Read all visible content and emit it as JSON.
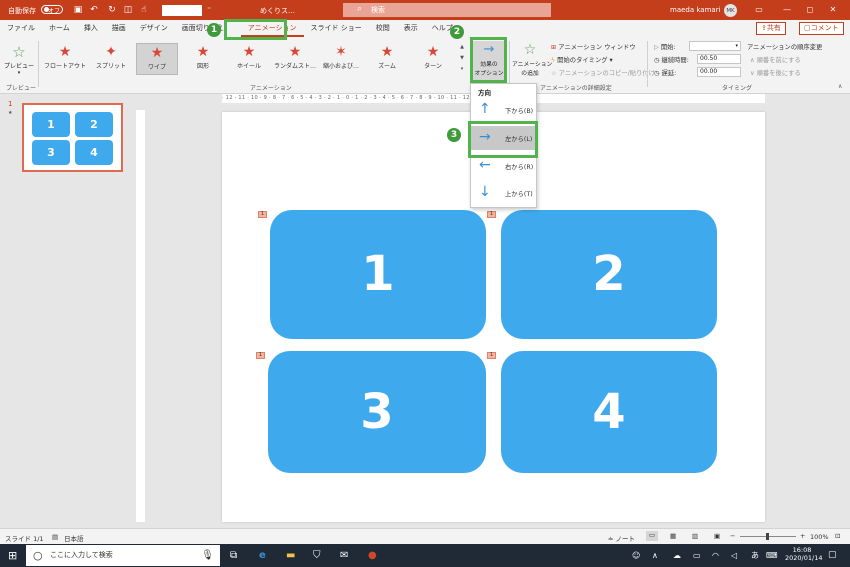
{
  "titlebar": {
    "autosave_label": "自動保存",
    "autosave_state": "オフ",
    "file_name": "めくりス…",
    "search_placeholder": "検索",
    "user_name": "maeda kamari",
    "user_initials": "MK",
    "bg_color": "#c43e1c"
  },
  "tabs": [
    {
      "label": "ファイル"
    },
    {
      "label": "ホーム"
    },
    {
      "label": "挿入"
    },
    {
      "label": "描画"
    },
    {
      "label": "デザイン"
    },
    {
      "label": "画面切り替え"
    },
    {
      "label": "アニメーション",
      "active": true
    },
    {
      "label": "スライド ショー"
    },
    {
      "label": "校閲"
    },
    {
      "label": "表示"
    },
    {
      "label": "ヘルプ"
    }
  ],
  "share_label": "共有",
  "comment_label": "コメント",
  "ribbon": {
    "preview_label": "プレビュー",
    "preview_group": "プレビュー",
    "animation_group": "アニメーション",
    "animations": [
      {
        "label": "フロートアウト"
      },
      {
        "label": "スプリット"
      },
      {
        "label": "ワイプ",
        "selected": true
      },
      {
        "label": "図形"
      },
      {
        "label": "ホイール"
      },
      {
        "label": "ランダムスト…"
      },
      {
        "label": "縮小および…"
      },
      {
        "label": "ズーム"
      },
      {
        "label": "ターン"
      }
    ],
    "effect_options_line1": "効果の",
    "effect_options_line2": "オプション",
    "add_animation_line1": "アニメーション",
    "add_animation_line2": "の追加",
    "animation_pane": "アニメーション ウィンドウ",
    "trigger": "開始のタイミング",
    "painter": "アニメーションのコピー/貼り付け",
    "detail_group": "アニメーションの詳細設定",
    "start_label": "開始:",
    "duration_label": "継続時間:",
    "duration_value": "00.50",
    "delay_label": "遅延:",
    "delay_value": "00.00",
    "reorder_label": "アニメーションの順序変更",
    "move_earlier": "順番を前にする",
    "move_later": "順番を後にする",
    "timing_group": "タイミング"
  },
  "dropdown": {
    "header": "方向",
    "items": [
      {
        "label": "下から(B)",
        "icon": "arrow-up-icon"
      },
      {
        "label": "左から(L)",
        "icon": "arrow-right-icon",
        "selected": true
      },
      {
        "label": "右から(R)",
        "icon": "arrow-left-icon"
      },
      {
        "label": "上から(T)",
        "icon": "arrow-down-icon"
      }
    ]
  },
  "badges": [
    "1",
    "2",
    "3"
  ],
  "thumbnail": {
    "slide_number": "1",
    "star": "★",
    "cells": [
      "1",
      "2",
      "3",
      "4"
    ]
  },
  "ruler_text": "· 12 · 11 · 10 · 9 · 8 · 7 · 6 · 5 · 4 · 3 · 2 · 1 · 0 · 1 · 2 · 3 · 4 · 5 · 6 · 7 · 8 · 9 · 10 · 11 · 12 ·",
  "slide": {
    "boxes": [
      "1",
      "2",
      "3",
      "4"
    ],
    "tag": "1",
    "box_color": "#3fa9ee"
  },
  "status": {
    "slide_info": "スライド 1/1",
    "language": "日本語",
    "notes": "ノート",
    "zoom": "100%"
  },
  "taskbar": {
    "search_placeholder": "ここに入力して検索",
    "ime": "あ",
    "time": "16:08",
    "date": "2020/01/14"
  }
}
